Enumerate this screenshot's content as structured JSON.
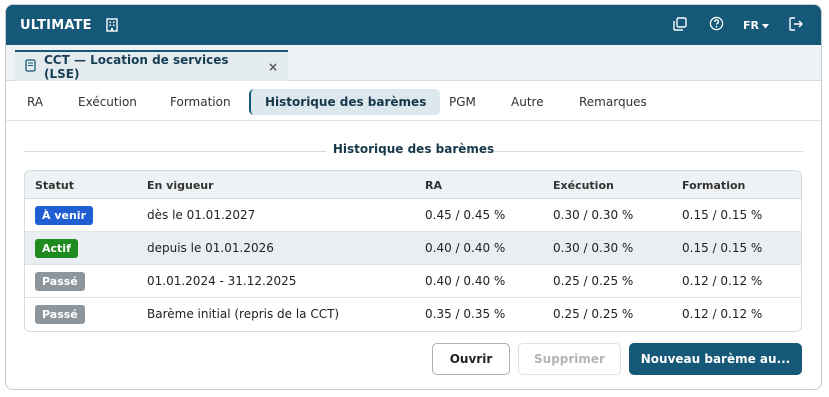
{
  "app": {
    "brand": "ULTIMATE",
    "language": "FR"
  },
  "document_tab": {
    "title": "CCT — Location de services (LSE)",
    "close": "×"
  },
  "subtabs": [
    "RA",
    "Exécution",
    "Formation",
    "Historique des barèmes",
    "PGM",
    "Autre",
    "Remarques"
  ],
  "active_subtab": "Historique des barèmes",
  "section": {
    "title": "Historique des barèmes"
  },
  "table": {
    "headers": {
      "statut": "Statut",
      "en_vigueur": "En vigueur",
      "ra": "RA",
      "execution": "Exécution",
      "formation": "Formation"
    },
    "rows": [
      {
        "status": "À venir",
        "status_color": "#1f5fd1",
        "period": "dès le 01.01.2027",
        "ra": "0.45 / 0.45 %",
        "execution": "0.30 / 0.30 %",
        "formation": "0.15 / 0.15 %"
      },
      {
        "status": "Actif",
        "status_color": "#1f8a1f",
        "period": "depuis le 01.01.2026",
        "ra": "0.40 / 0.40 %",
        "execution": "0.30 / 0.30 %",
        "formation": "0.15 / 0.15 %"
      },
      {
        "status": "Passé",
        "status_color": "#8d969c",
        "period": "01.01.2024 - 31.12.2025",
        "ra": "0.40 / 0.40 %",
        "execution": "0.25 / 0.25 %",
        "formation": "0.12 / 0.12 %"
      },
      {
        "status": "Passé",
        "status_color": "#8d969c",
        "period": "Barème initial (repris de la CCT)",
        "ra": "0.35 / 0.35 %",
        "execution": "0.25 / 0.25 %",
        "formation": "0.12 / 0.12 %"
      }
    ]
  },
  "actions": {
    "open": "Ouvrir",
    "delete": "Supprimer",
    "new": "Nouveau barème au..."
  },
  "colors": {
    "primary": "#155877",
    "active_tab_bg": "#dce8ed"
  }
}
